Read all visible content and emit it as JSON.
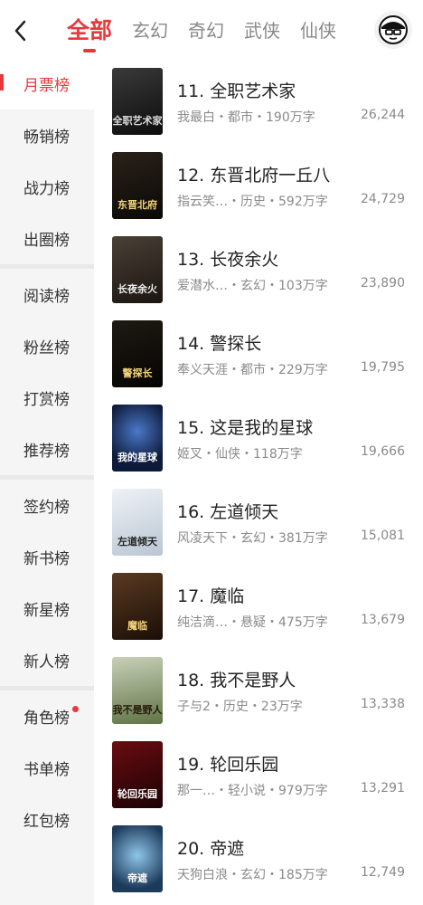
{
  "colors": {
    "accent": "#e8383d"
  },
  "header": {
    "back_icon": "chevron-left-icon",
    "tabs": [
      "全部",
      "玄幻",
      "奇幻",
      "武侠",
      "仙侠"
    ],
    "active_tab": 0,
    "avatar_icon": "user-avatar-icon"
  },
  "sidebar": {
    "groups": [
      [
        "月票榜",
        "畅销榜",
        "战力榜",
        "出圈榜"
      ],
      [
        "阅读榜",
        "粉丝榜",
        "打赏榜",
        "推荐榜"
      ],
      [
        "签约榜",
        "新书榜",
        "新星榜",
        "新人榜"
      ],
      [
        "角色榜",
        "书单榜",
        "红包榜"
      ]
    ],
    "active": "月票榜",
    "badge_item": "角色榜"
  },
  "books": [
    {
      "rank_title": "11. 全职艺术家",
      "meta": "我最白・都市・190万字",
      "count": "26,244",
      "cover_text": "全职艺术家"
    },
    {
      "rank_title": "12. 东晋北府一丘八",
      "meta": "指云笑…・历史・592万字",
      "count": "24,729",
      "cover_text": "东晋北府"
    },
    {
      "rank_title": "13. 长夜余火",
      "meta": "爱潜水…・玄幻・103万字",
      "count": "23,890",
      "cover_text": "长夜余火"
    },
    {
      "rank_title": "14. 警探长",
      "meta": "奉义天涯・都市・229万字",
      "count": "19,795",
      "cover_text": "警探长"
    },
    {
      "rank_title": "15. 这是我的星球",
      "meta": "姬叉・仙侠・118万字",
      "count": "19,666",
      "cover_text": "我的星球"
    },
    {
      "rank_title": "16. 左道倾天",
      "meta": "风凌天下・玄幻・381万字",
      "count": "15,081",
      "cover_text": "左道倾天"
    },
    {
      "rank_title": "17. 魔临",
      "meta": "纯洁滴…・悬疑・475万字",
      "count": "13,679",
      "cover_text": "魔临"
    },
    {
      "rank_title": "18. 我不是野人",
      "meta": "子与2・历史・23万字",
      "count": "13,338",
      "cover_text": "我不是野人"
    },
    {
      "rank_title": "19. 轮回乐园",
      "meta": "那一…・轻小说・979万字",
      "count": "13,291",
      "cover_text": "轮回乐园"
    },
    {
      "rank_title": "20. 帝遮",
      "meta": "天狗白浪・玄幻・185万字",
      "count": "12,749",
      "cover_text": "帝遮"
    }
  ]
}
